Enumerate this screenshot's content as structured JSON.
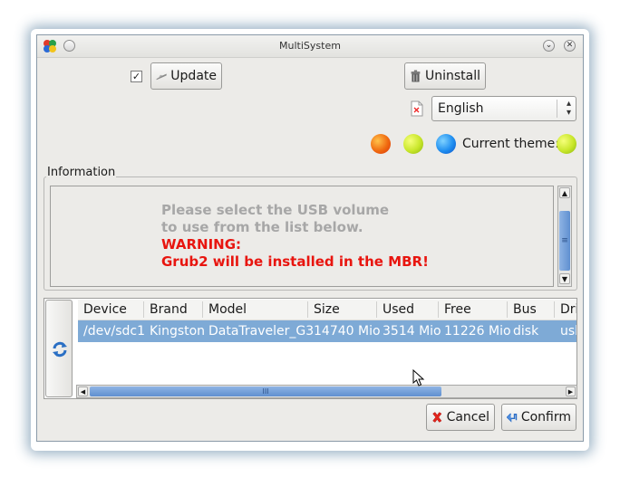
{
  "window": {
    "title": "MultiSystem"
  },
  "toolbar": {
    "update_checked": true,
    "update_label": "Update",
    "uninstall_label": "Uninstall"
  },
  "language": {
    "selected": "English"
  },
  "theme": {
    "label": "Current theme:",
    "options": [
      "orange",
      "lime",
      "blue"
    ],
    "current": "lime"
  },
  "info": {
    "legend": "Information",
    "line1": "Please select the USB volume",
    "line2": "to use from the list below.",
    "warning1": "WARNING:",
    "warning2": "Grub2 will be installed in the MBR!"
  },
  "table": {
    "columns": [
      "Device",
      "Brand",
      "Model",
      "Size",
      "Used",
      "Free",
      "Bus",
      "Dri"
    ],
    "rows": [
      [
        "/dev/sdc1",
        "Kingston",
        "DataTraveler_G3",
        "14740 Mio",
        "3514 Mio",
        "11226 Mio",
        "disk",
        "usb"
      ]
    ]
  },
  "scroll_glyph": {
    "v": "≡",
    "h": "III"
  },
  "buttons": {
    "cancel": "Cancel",
    "confirm": "Confirm"
  },
  "colors": {
    "selection": "#7eaad6",
    "warning": "#e8150f",
    "info_grey": "#a7a7a7"
  }
}
